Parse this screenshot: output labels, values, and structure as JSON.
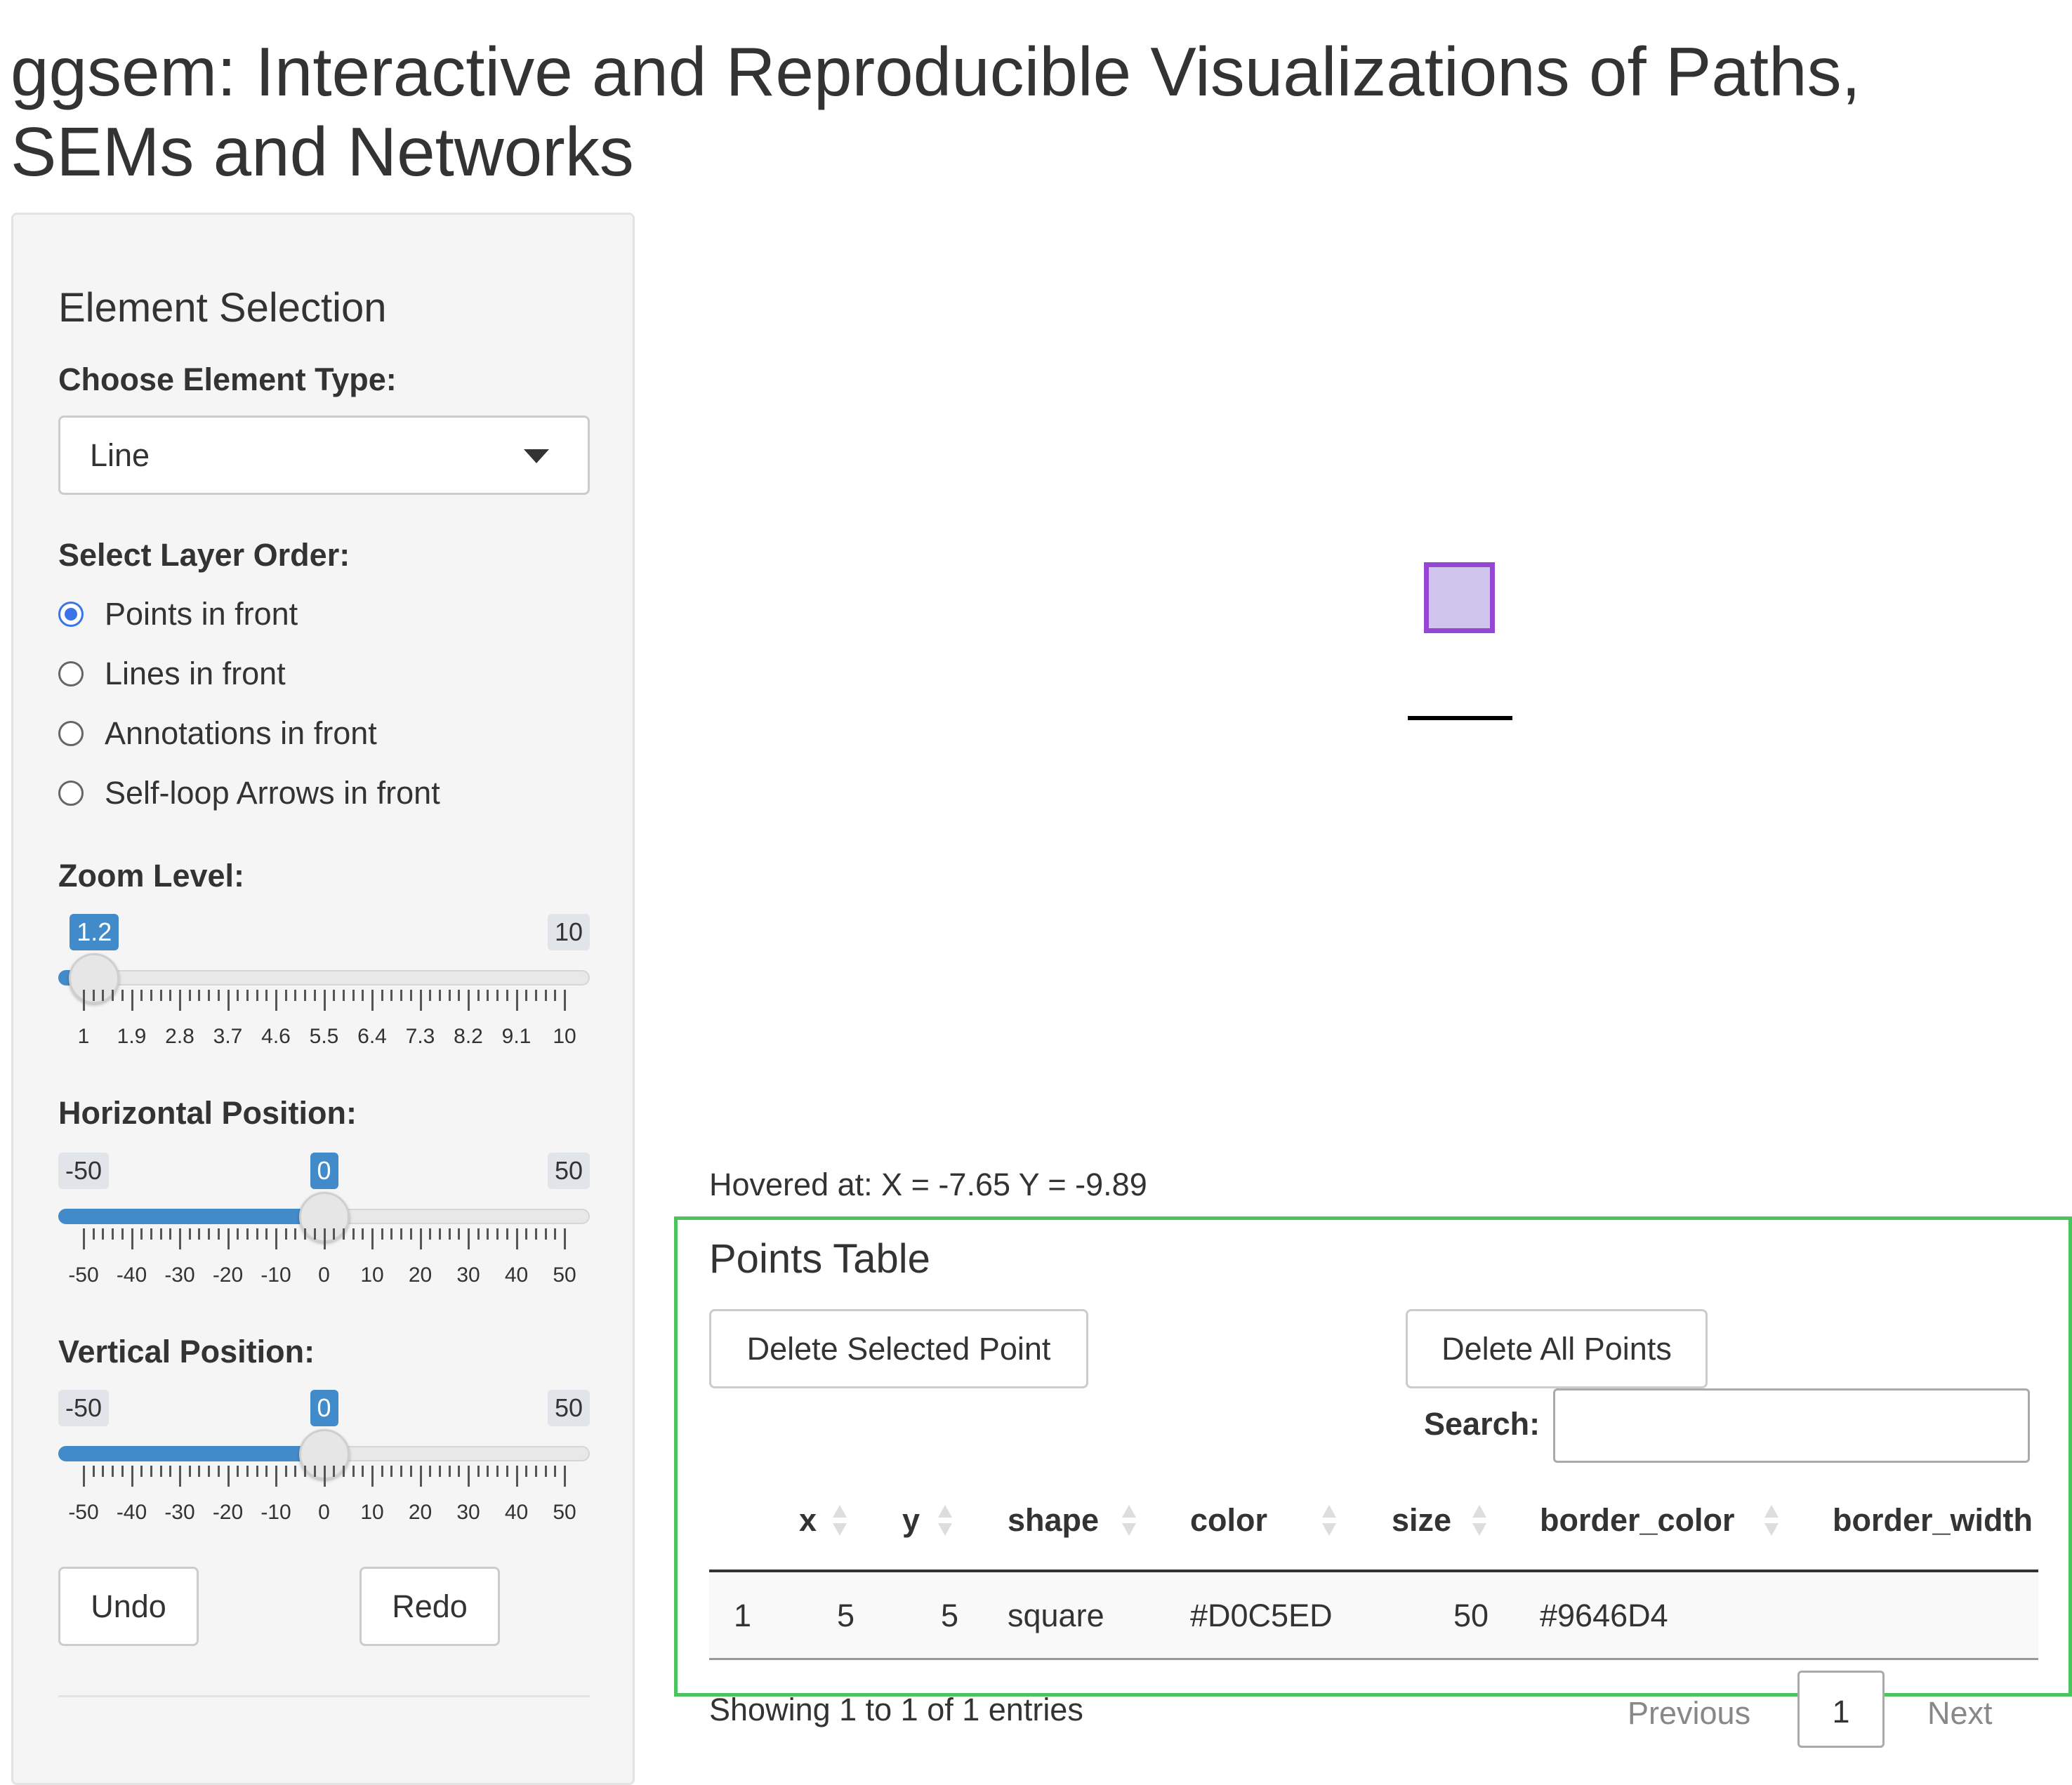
{
  "page_title": "ggsem: Interactive and Reproducible Visualizations of Paths, SEMs and Networks",
  "sidebar": {
    "heading": "Element Selection",
    "element_type_label": "Choose Element Type:",
    "element_type_value": "Line",
    "layer_order_label": "Select Layer Order:",
    "layer_options": [
      {
        "label": "Points in front",
        "checked": true
      },
      {
        "label": "Lines in front",
        "checked": false
      },
      {
        "label": "Annotations in front",
        "checked": false
      },
      {
        "label": "Self-loop Arrows in front",
        "checked": false
      }
    ],
    "zoom": {
      "label": "Zoom Level:",
      "min": "1",
      "max": "10",
      "max_bubble": "10",
      "value": "1.2",
      "value_num": 1.2,
      "min_num": 1,
      "max_num": 10,
      "ticks": [
        "1",
        "1.9",
        "2.8",
        "3.7",
        "4.6",
        "5.5",
        "6.4",
        "7.3",
        "8.2",
        "9.1",
        "10"
      ]
    },
    "horizontal": {
      "label": "Horizontal Position:",
      "min": "-50",
      "max": "50",
      "value": "0",
      "value_num": 0,
      "min_num": -50,
      "max_num": 50,
      "ticks": [
        "-50",
        "-40",
        "-30",
        "-20",
        "-10",
        "0",
        "10",
        "20",
        "30",
        "40",
        "50"
      ]
    },
    "vertical": {
      "label": "Vertical Position:",
      "min": "-50",
      "max": "50",
      "value": "0",
      "value_num": 0,
      "min_num": -50,
      "max_num": 50,
      "ticks": [
        "-50",
        "-40",
        "-30",
        "-20",
        "-10",
        "0",
        "10",
        "20",
        "30",
        "40",
        "50"
      ]
    },
    "undo_label": "Undo",
    "redo_label": "Redo"
  },
  "plot": {
    "point_fill": "#D0C5ED",
    "point_border": "#9646D4",
    "line_color": "#000000"
  },
  "hover_text": "Hovered at: X = -7.65 Y = -9.89",
  "points_table": {
    "title": "Points Table",
    "delete_selected_label": "Delete Selected Point",
    "delete_all_label": "Delete All Points",
    "search_label": "Search:",
    "search_value": "",
    "columns": [
      "x",
      "y",
      "shape",
      "color",
      "size",
      "border_color",
      "border_width"
    ],
    "rows": [
      {
        "index": "1",
        "x": "5",
        "y": "5",
        "shape": "square",
        "color": "#D0C5ED",
        "size": "50",
        "border_color": "#9646D4",
        "border_width": ""
      }
    ],
    "info": "Showing 1 to 1 of 1 entries",
    "previous_label": "Previous",
    "page": "1",
    "next_label": "Next"
  },
  "colors": {
    "accent": "#428bca",
    "radio_checked": "#3b73e8",
    "highlight_border": "#4cc35b"
  }
}
